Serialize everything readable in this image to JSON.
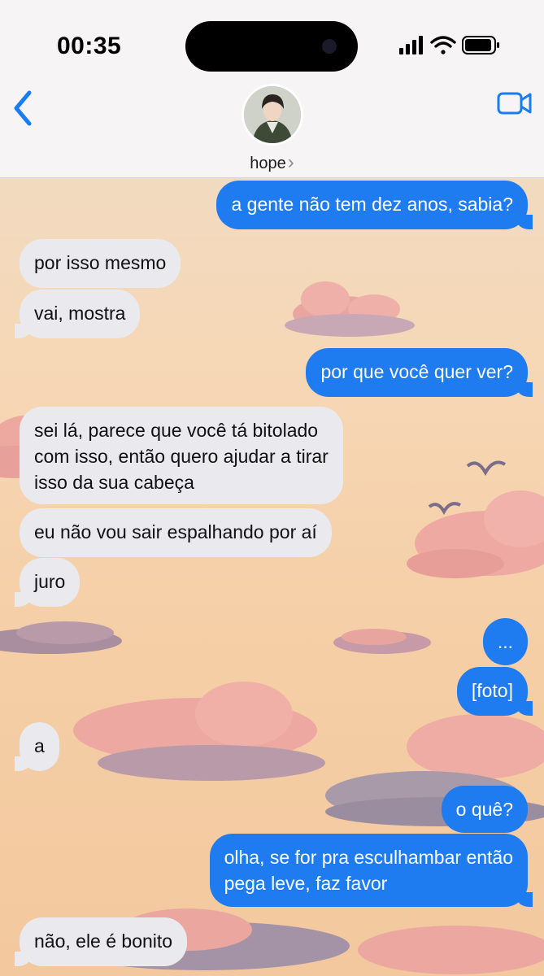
{
  "status": {
    "time": "00:35"
  },
  "contact": {
    "name": "hope",
    "chevron": "›"
  },
  "colors": {
    "sent_bubble": "#1f7cf0",
    "received_bubble": "#e9e9ee",
    "accent": "#1a7cf5"
  },
  "icons": [
    "back-chevron-icon",
    "video-call-icon",
    "signal-icon",
    "wifi-icon",
    "battery-icon"
  ],
  "messages": [
    {
      "side": "sent",
      "text": "a gente não tem dez anos, sabia?"
    },
    {
      "side": "received",
      "text": "por isso mesmo"
    },
    {
      "side": "received",
      "text": "vai, mostra"
    },
    {
      "side": "sent",
      "text": "por que você quer ver?"
    },
    {
      "side": "received",
      "text": "sei lá, parece que você tá bitolado\ncom isso, então quero ajudar a tirar\nisso da sua cabeça"
    },
    {
      "side": "received",
      "text": "eu não vou sair espalhando por aí"
    },
    {
      "side": "received",
      "text": "juro"
    },
    {
      "side": "sent",
      "text": "..."
    },
    {
      "side": "sent",
      "text": "[foto]"
    },
    {
      "side": "received",
      "text": "a"
    },
    {
      "side": "sent",
      "text": "o quê?"
    },
    {
      "side": "sent",
      "text": "olha, se for pra esculhambar então\npega leve, faz favor"
    },
    {
      "side": "received",
      "text": "não, ele é bonito"
    }
  ]
}
